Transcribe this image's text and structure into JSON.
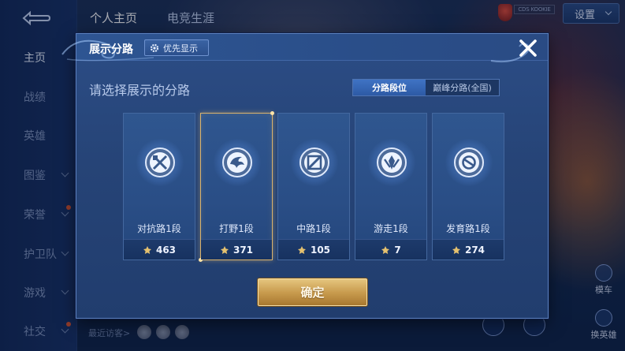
{
  "top_tabs": [
    "个人主页",
    "电竞生涯"
  ],
  "settings": {
    "label": "设置"
  },
  "rank_tag": "CDS KOOKIE",
  "left_nav": {
    "items": [
      {
        "label": "主页",
        "active": true,
        "has_chevron": false
      },
      {
        "label": "战绩",
        "active": false,
        "has_chevron": false
      },
      {
        "label": "英雄",
        "active": false,
        "has_chevron": false
      },
      {
        "label": "图鉴",
        "active": false,
        "has_chevron": true
      },
      {
        "label": "荣誉",
        "active": false,
        "has_chevron": true
      },
      {
        "label": "护卫队",
        "active": false,
        "has_chevron": true
      },
      {
        "label": "游戏",
        "active": false,
        "has_chevron": true
      },
      {
        "label": "社交",
        "active": false,
        "has_chevron": true
      }
    ]
  },
  "recent_visitors": "最近访客>",
  "side_buttons": {
    "top_label": "模车",
    "bottom_label": "换英雄"
  },
  "dialog": {
    "title": "展示分路",
    "priority_button": "优先显示",
    "prompt": "请选择展示的分路",
    "segments": [
      {
        "label": "分路段位",
        "active": true
      },
      {
        "label": "巅峰分路(全国)",
        "active": false
      }
    ],
    "lanes": [
      {
        "name": "对抗路1段",
        "score": "463",
        "icon": "clash-lane-icon",
        "selected": false
      },
      {
        "name": "打野1段",
        "score": "371",
        "icon": "jungle-icon",
        "selected": true
      },
      {
        "name": "中路1段",
        "score": "105",
        "icon": "mid-lane-icon",
        "selected": false
      },
      {
        "name": "游走1段",
        "score": "7",
        "icon": "roam-icon",
        "selected": false
      },
      {
        "name": "发育路1段",
        "score": "274",
        "icon": "farm-lane-icon",
        "selected": false
      }
    ],
    "confirm_label": "确定"
  },
  "colors": {
    "dialog_bg": "#264477",
    "selected_border": "#d9b26d",
    "confirm_gold": "#c99c4f",
    "segment_active": "#3f73c4"
  }
}
